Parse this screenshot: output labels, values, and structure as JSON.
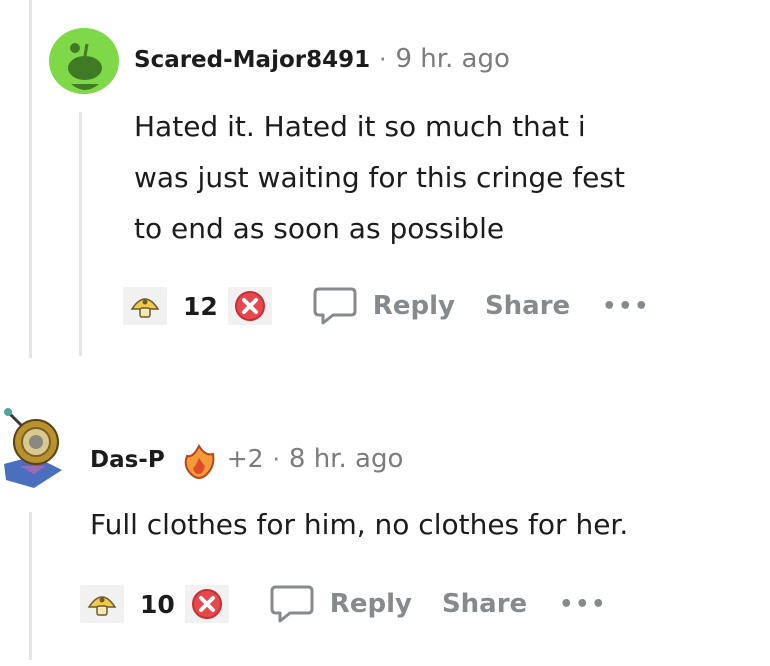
{
  "comments": [
    {
      "author": "Scared-Major8491",
      "separator": "·",
      "time": "9 hr. ago",
      "body_lines": [
        "Hated it. Hated it so much that i",
        "was just waiting for this cringe fest",
        "to end as soon as possible"
      ],
      "score": "12",
      "reply_label": "Reply",
      "share_label": "Share",
      "more_label": "•••",
      "avatar_icon": "snoo-default-avatar-icon"
    },
    {
      "author": "Das-P",
      "flair_count": "+2",
      "separator": "·",
      "time": "8 hr. ago",
      "body_lines": [
        "Full clothes for him, no clothes for her."
      ],
      "score": "10",
      "reply_label": "Reply",
      "share_label": "Share",
      "more_label": "•••",
      "avatar_icon": "robot-diver-avatar-icon"
    }
  ],
  "colors": {
    "meta_gray": "#7c7c7c",
    "action_gray": "#878a8c",
    "thread_line": "#e5e5e5",
    "avatar_green": "#7fd847",
    "downvote_red": "#e8474b"
  }
}
